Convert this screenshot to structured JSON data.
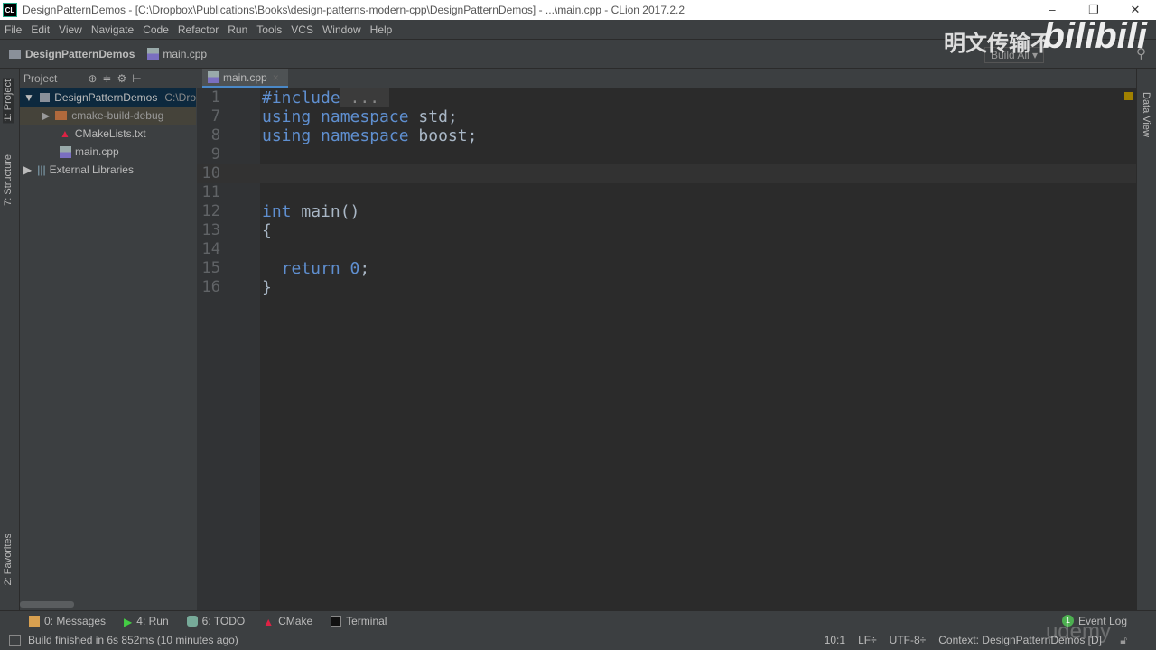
{
  "window": {
    "title": "DesignPatternDemos - [C:\\Dropbox\\Publications\\Books\\design-patterns-modern-cpp\\DesignPatternDemos] - ...\\main.cpp - CLion 2017.2.2",
    "logo": "CL",
    "controls": [
      "–",
      "❐",
      "✕"
    ]
  },
  "menu": [
    "File",
    "Edit",
    "View",
    "Navigate",
    "Code",
    "Refactor",
    "Run",
    "Tools",
    "VCS",
    "Window",
    "Help"
  ],
  "nav": {
    "project": "DesignPatternDemos",
    "file": "main.cpp",
    "build_config": "Build All"
  },
  "left_tabs": {
    "project": "1: Project",
    "structure": "7: Structure",
    "favorites": "2: Favorites"
  },
  "project_panel": {
    "title": "Project",
    "tree": [
      {
        "label": "DesignPatternDemos",
        "extra": "C:\\Dro",
        "type": "project"
      },
      {
        "label": "cmake-build-debug",
        "type": "folder"
      },
      {
        "label": "CMakeLists.txt",
        "type": "cmake"
      },
      {
        "label": "main.cpp",
        "type": "cpp"
      },
      {
        "label": "External Libraries",
        "type": "libs"
      }
    ]
  },
  "editor": {
    "tab": "main.cpp",
    "lines": [
      {
        "n": "1",
        "parts": [
          [
            "kw",
            "#include"
          ],
          [
            "",
            ""
          ],
          [
            "fold",
            " ... "
          ]
        ]
      },
      {
        "n": "7",
        "parts": [
          [
            "kw",
            "using namespace "
          ],
          [
            "",
            "std;"
          ]
        ]
      },
      {
        "n": "8",
        "parts": [
          [
            "kw",
            "using namespace "
          ],
          [
            "",
            "boost;"
          ]
        ]
      },
      {
        "n": "9",
        "parts": []
      },
      {
        "n": "10",
        "parts": []
      },
      {
        "n": "11",
        "parts": []
      },
      {
        "n": "12",
        "parts": [
          [
            "kw",
            "int "
          ],
          [
            "",
            "main()"
          ]
        ]
      },
      {
        "n": "13",
        "parts": [
          [
            "",
            "{"
          ]
        ]
      },
      {
        "n": "14",
        "parts": []
      },
      {
        "n": "15",
        "parts": [
          [
            "kw",
            "  return "
          ],
          [
            "kw",
            "0"
          ],
          [
            "",
            ";"
          ]
        ]
      },
      {
        "n": "16",
        "parts": [
          [
            "",
            "}"
          ]
        ]
      }
    ]
  },
  "right_tabs": {
    "data_view": "Data View"
  },
  "tool_windows": [
    "0: Messages",
    "4: Run",
    "6: TODO",
    "CMake",
    "Terminal"
  ],
  "event_log": {
    "label": "Event Log",
    "count": "1"
  },
  "status": {
    "message": "Build finished in 6s 852ms (10 minutes ago)",
    "position": "10:1",
    "line_sep": "LF÷",
    "encoding": "UTF-8÷",
    "context": "Context: DesignPatternDemos [D]"
  },
  "watermarks": {
    "text": "明文传输不",
    "logo": "bilibili",
    "udemy": "udemy"
  }
}
